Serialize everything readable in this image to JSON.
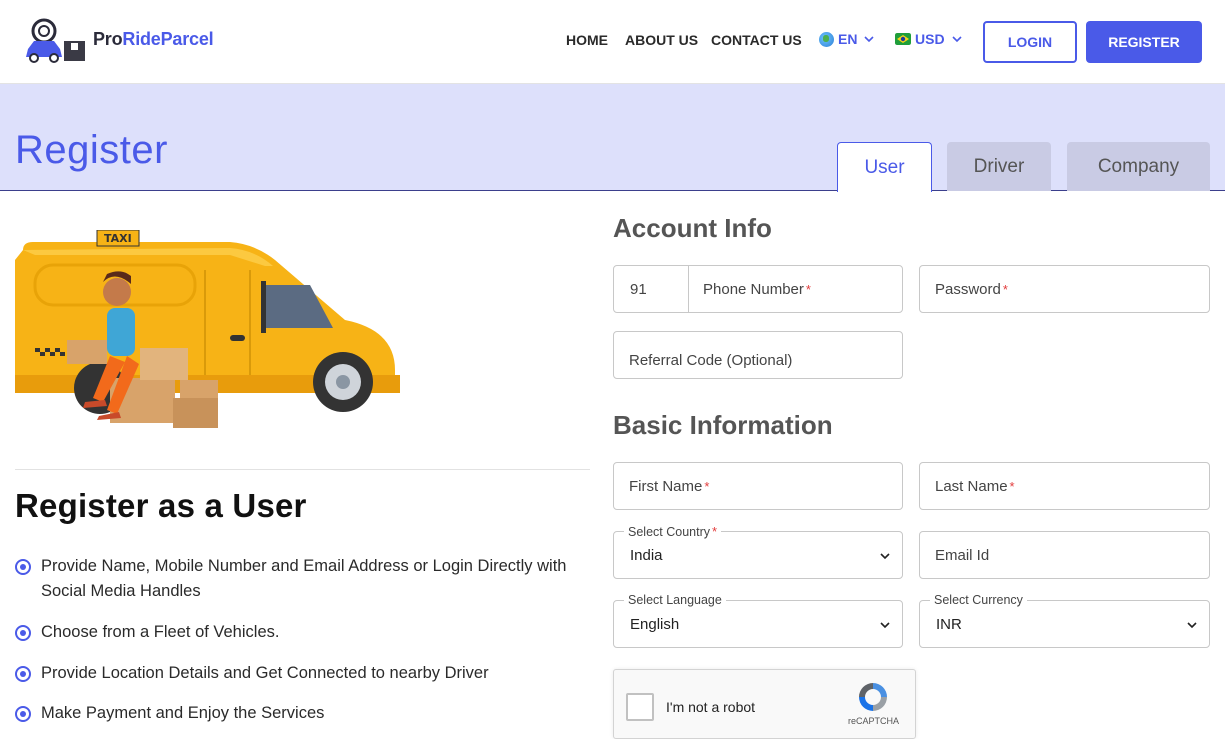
{
  "header": {
    "logo_part1": "Pro",
    "logo_part2": "RideParcel",
    "nav": [
      "HOME",
      "ABOUT US",
      "CONTACT US"
    ],
    "language": "EN",
    "currency": "USD",
    "login_label": "LOGIN",
    "register_label": "REGISTER"
  },
  "banner": {
    "title": "Register",
    "tabs": [
      "User",
      "Driver",
      "Company"
    ],
    "active_tab": "User"
  },
  "left": {
    "van_sign": "TAXI",
    "heading": "Register as a User",
    "bullets": [
      "Provide Name, Mobile Number and Email Address or Login Directly with Social Media Handles",
      "Choose from a Fleet of Vehicles.",
      "Provide Location Details and Get Connected to nearby Driver",
      "Make Payment and Enjoy the Services"
    ]
  },
  "form": {
    "account_title": "Account Info",
    "phone_code": "91",
    "phone_placeholder": "Phone Number",
    "password_placeholder": "Password",
    "referral_placeholder": "Referral Code (Optional)",
    "basic_title": "Basic Information",
    "first_name_placeholder": "First Name",
    "last_name_placeholder": "Last Name",
    "country_label": "Select Country",
    "country_value": "India",
    "email_placeholder": "Email Id",
    "language_label": "Select Language",
    "language_value": "English",
    "currency_label": "Select Currency",
    "currency_value": "INR",
    "required_mark": "*"
  },
  "captcha": {
    "text": "I'm not a robot",
    "brand": "reCAPTCHA"
  },
  "colors": {
    "accent": "#4a5ae8",
    "banner_bg": "#dde0fb",
    "required": "#e23b3b"
  }
}
